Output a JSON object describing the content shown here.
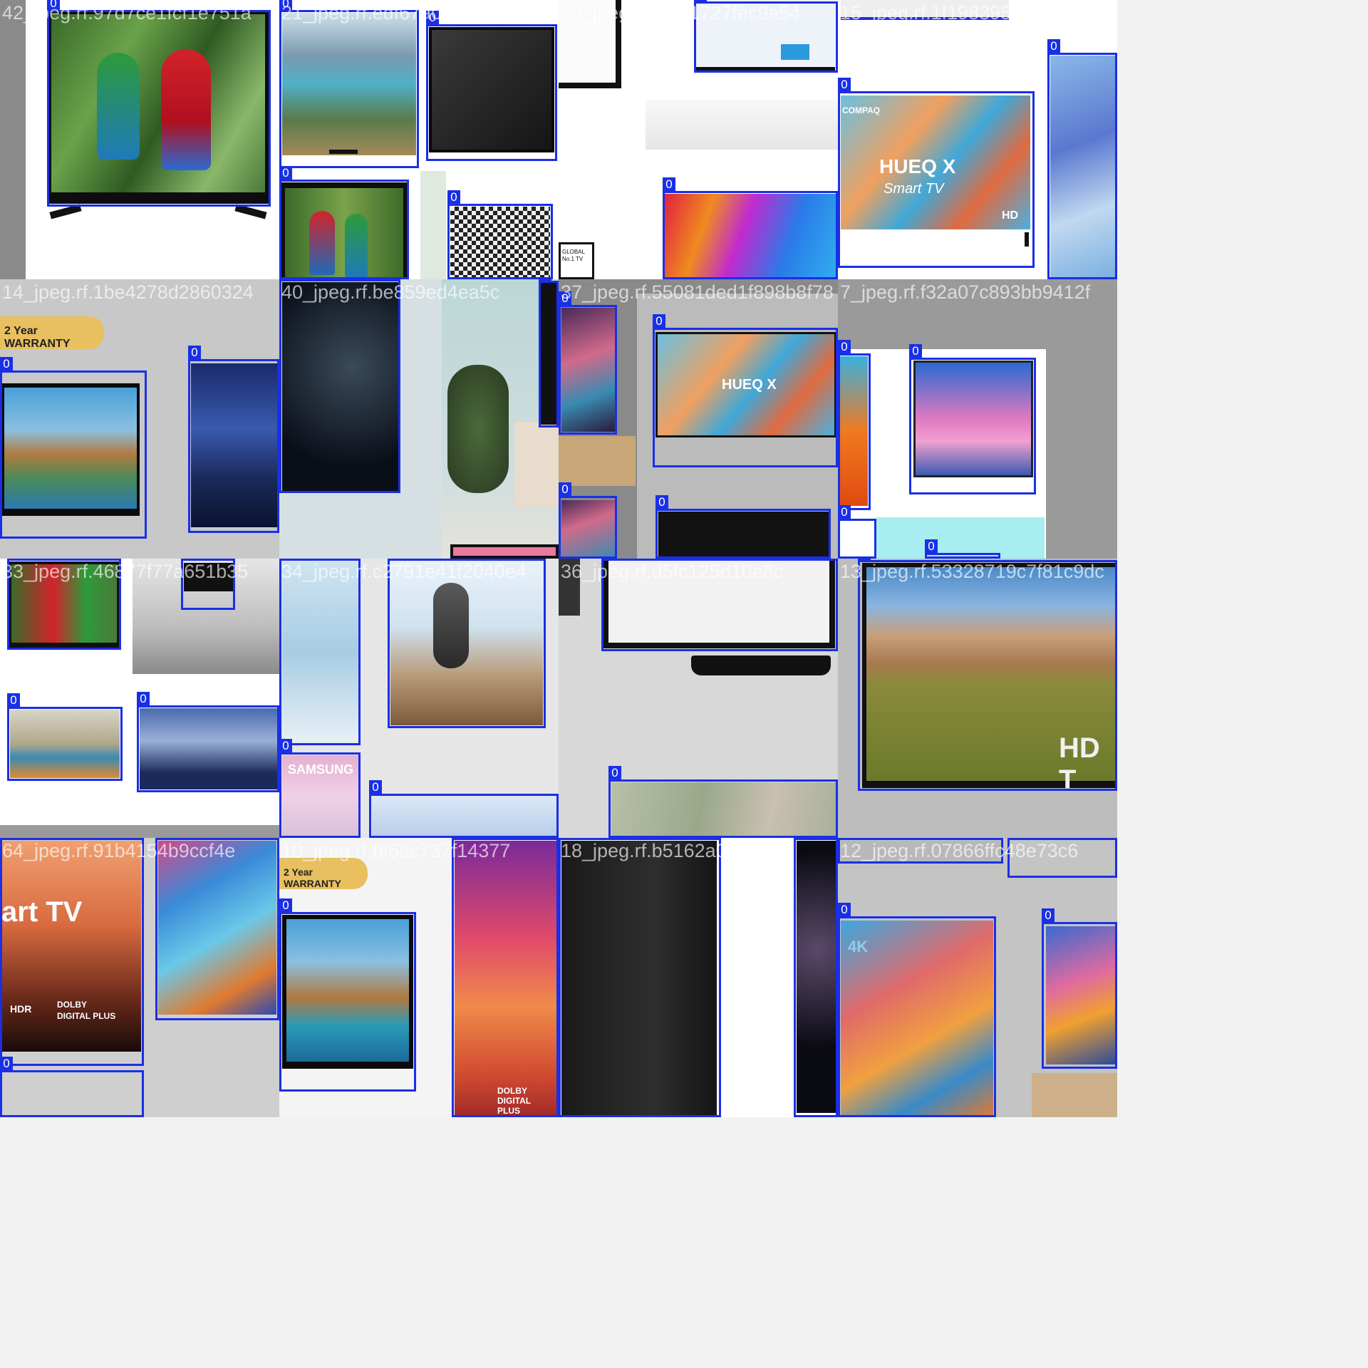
{
  "class_label": "0",
  "tiles": [
    {
      "id": "t1",
      "file": "42_jpeg.rf.97d7ce1fcf1e751a"
    },
    {
      "id": "t2",
      "file": "21_jpeg.rf.edf67a00eb729"
    },
    {
      "id": "t3",
      "file": "29_jpeg.rf.f37a1727fec9a54"
    },
    {
      "id": "t4",
      "file": "15_jpeg.rf.1f19839505bc298ff"
    },
    {
      "id": "t5",
      "file": "14_jpeg.rf.1be4278d2860324"
    },
    {
      "id": "t6",
      "file": "40_jpeg.rf.be859ed4ea5c"
    },
    {
      "id": "t7",
      "file": "37_jpeg.rf.55081ded1f898b8f78"
    },
    {
      "id": "t8",
      "file": "7_jpeg.rf.f32a07c893bb9412f"
    },
    {
      "id": "t9",
      "file": "33_jpeg.rf.46877f77a651b35"
    },
    {
      "id": "t10",
      "file": "34_jpeg.rf.c2791e41f2040e4"
    },
    {
      "id": "t11",
      "file": "36_jpeg.rf.d5fc125d10e8c"
    },
    {
      "id": "t12",
      "file": "13_jpeg.rf.53328719c7f81c9dc"
    },
    {
      "id": "t13",
      "file": "64_jpeg.rf.91b4154b9ccf4e"
    },
    {
      "id": "t14",
      "file": "10_jpeg.rf.bf6ac737f14377"
    },
    {
      "id": "t15",
      "file": "18_jpeg.rf.b5162a091bf50"
    },
    {
      "id": "t16",
      "file": "12_jpeg.rf.07866ffc48e73c6"
    }
  ],
  "screen_text": {
    "brand_compaq": "COMPAQ",
    "hueq": "HUEQ X",
    "smart_tv": "Smart TV",
    "hd": "HD",
    "warranty_badge": "2 Year WARRANTY",
    "samsung": "SAMSUNG",
    "hdr": "HDR",
    "dolby": "DOLBY DIGITAL PLUS",
    "art_tv": "art TV",
    "hd_t": "HD T",
    "four_k": "4K",
    "global": "GLOBAL No.1 TV"
  },
  "colors": {
    "box": "#1a2fe6",
    "background": "#d9d9d9"
  }
}
